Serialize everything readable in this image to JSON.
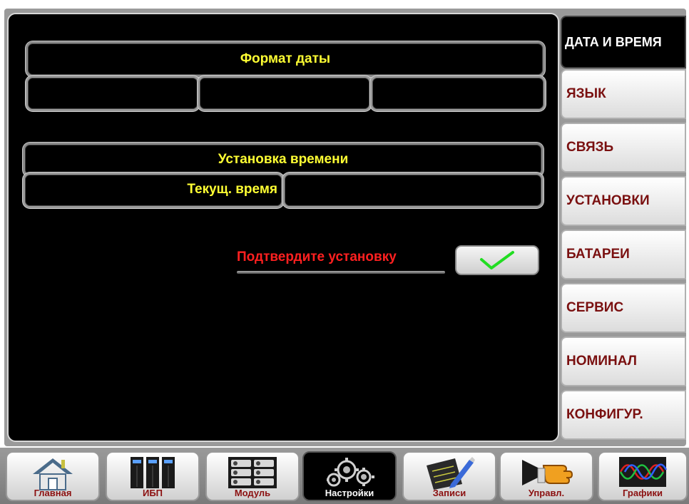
{
  "date_format": {
    "title": "Формат даты",
    "fields": [
      "",
      "",
      ""
    ]
  },
  "time_setting": {
    "title": "Установка времени",
    "current_time_label": "Текущ. время",
    "current_time_value": ""
  },
  "confirm": {
    "text": "Подтвердите установку",
    "icon": "checkmark-icon",
    "icon_color": "#22dd22"
  },
  "side_menu": [
    {
      "label": "ДАТА И ВРЕМЯ",
      "active": true
    },
    {
      "label": "ЯЗЫК"
    },
    {
      "label": "СВЯЗЬ"
    },
    {
      "label": "УСТАНОВКИ"
    },
    {
      "label": "БАТАРЕИ"
    },
    {
      "label": "СЕРВИС"
    },
    {
      "label": "НОМИНАЛ"
    },
    {
      "label": "КОНФИГУР."
    }
  ],
  "bottom_nav": [
    {
      "label": "Главная",
      "icon": "home-icon"
    },
    {
      "label": "ИБП",
      "icon": "ups-cabinet-icon"
    },
    {
      "label": "Модуль",
      "icon": "module-rack-icon"
    },
    {
      "label": "Настройки",
      "icon": "gears-icon",
      "active": true
    },
    {
      "label": "Записи",
      "icon": "notepad-pen-icon"
    },
    {
      "label": "Управл.",
      "icon": "hand-pointer-icon"
    },
    {
      "label": "Графики",
      "icon": "waveform-icon"
    }
  ],
  "colors": {
    "accent_yellow": "#ffff33",
    "warning_red": "#ff2020",
    "menu_text": "#7a1010",
    "background": "#000000"
  }
}
